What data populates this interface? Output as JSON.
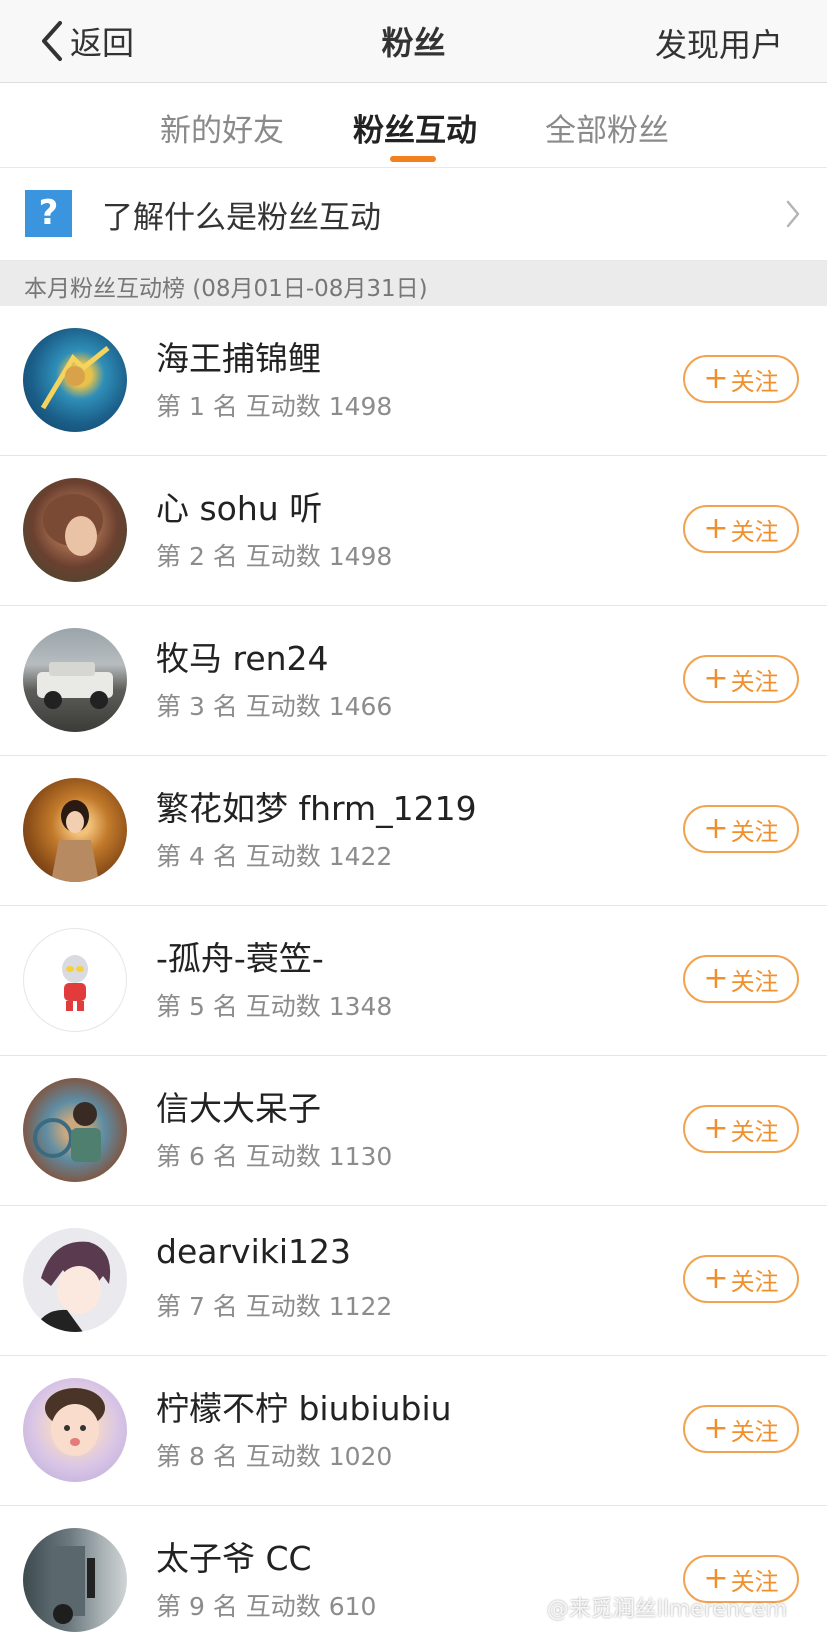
{
  "nav": {
    "back_label": "返回",
    "title": "粉丝",
    "discover_label": "发现用户"
  },
  "tabs": [
    {
      "label": "新的好友",
      "active": false
    },
    {
      "label": "粉丝互动",
      "active": true
    },
    {
      "label": "全部粉丝",
      "active": false
    }
  ],
  "info": {
    "icon": "question-icon",
    "icon_glyph": "?",
    "text": "了解什么是粉丝互动"
  },
  "section_header": "本月粉丝互动榜 (08月01日-08月31日)",
  "follow_plus": "+",
  "follow_label": "关注",
  "fans": [
    {
      "name": "海王捕锦鲤",
      "meta": "第 1 名  互动数 1498"
    },
    {
      "name": "心 sohu 听",
      "meta": "第 2 名  互动数 1498"
    },
    {
      "name": "牧马 ren24",
      "meta": "第 3 名  互动数 1466"
    },
    {
      "name": "繁花如梦 fhrm_1219",
      "meta": "第 4 名  互动数 1422"
    },
    {
      "name": "-孤舟-蓑笠-",
      "meta": "第 5 名  互动数 1348"
    },
    {
      "name": "信大大呆子",
      "meta": "第 6 名  互动数 1130"
    },
    {
      "name": "dearviki123",
      "meta": "第 7 名  互动数 1122"
    },
    {
      "name": "柠檬不柠 biubiubiu",
      "meta": "第 8 名  互动数 1020"
    },
    {
      "name": "太子爷 CC",
      "meta": "第 9 名  互动数 610"
    }
  ],
  "watermark": "@来觅润丝llmerencem",
  "colors": {
    "accent": "#f2801f",
    "follow_border": "#f0a451",
    "question_bg": "#3b94de"
  }
}
